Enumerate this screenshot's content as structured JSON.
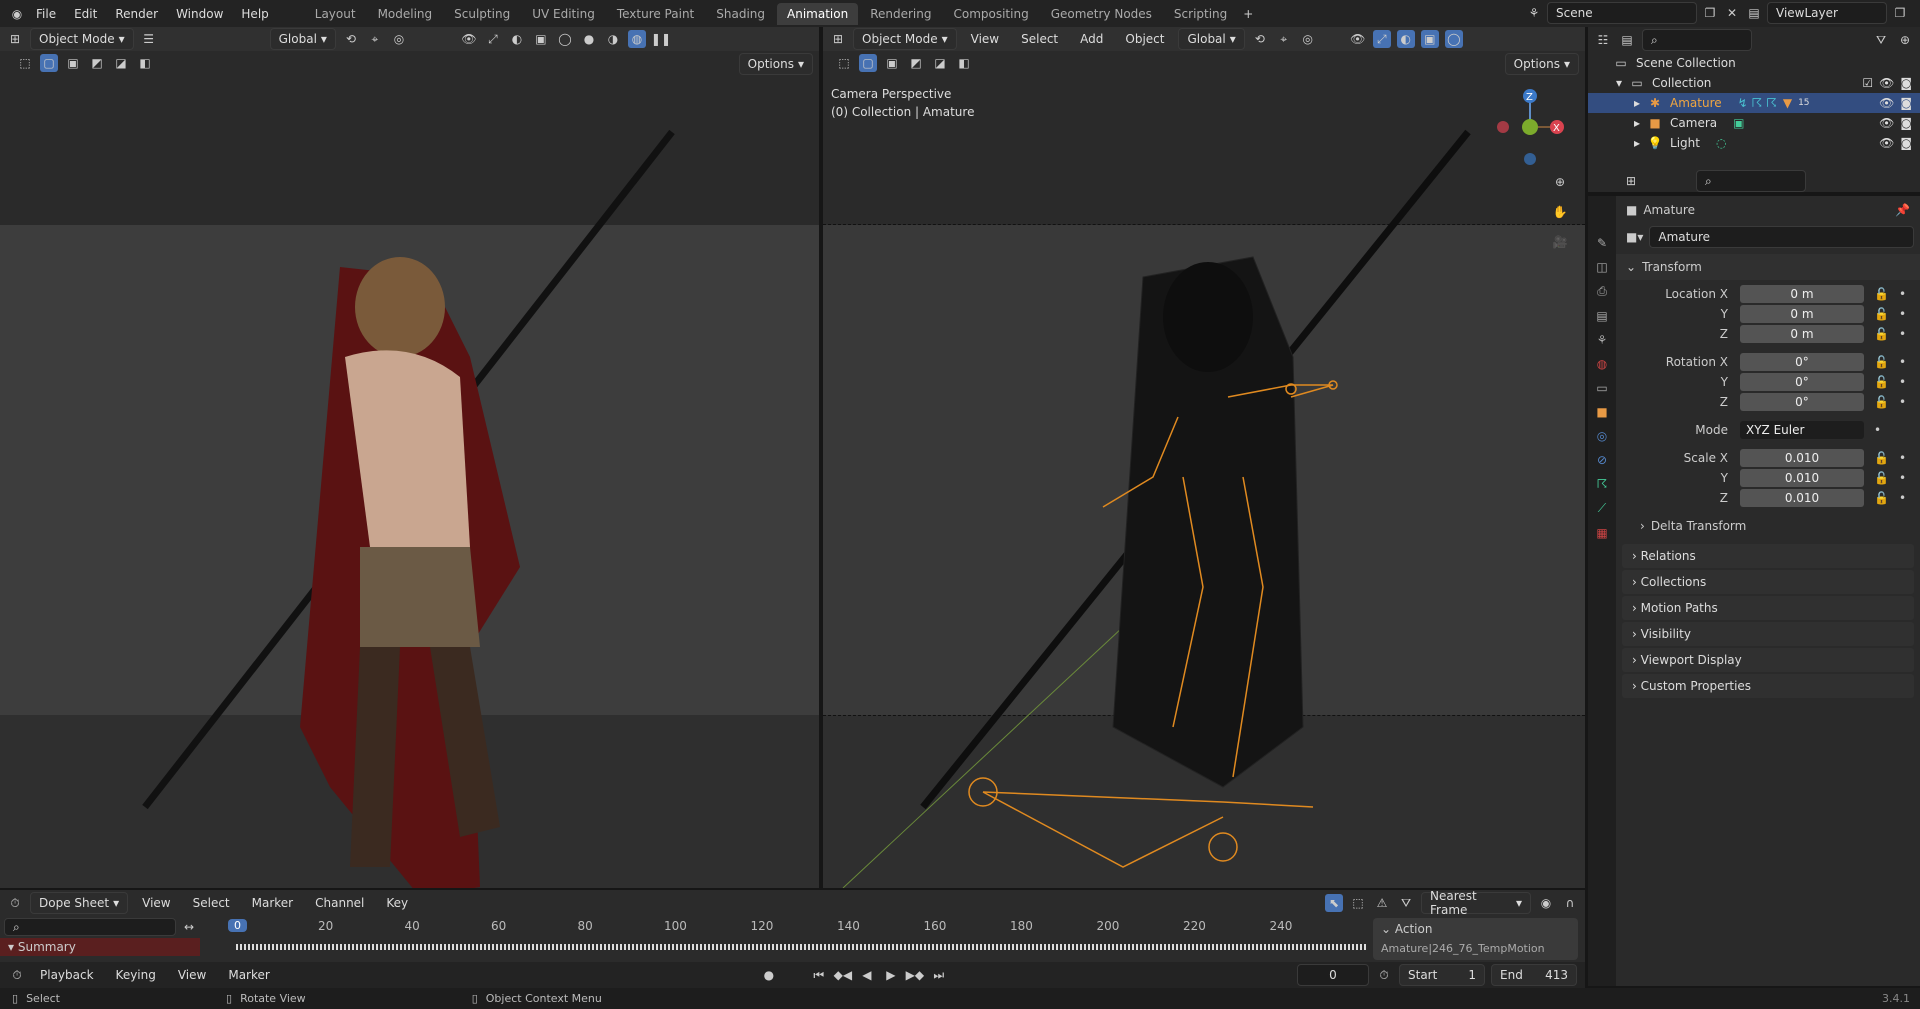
{
  "topbar": {
    "menus": [
      "File",
      "Edit",
      "Render",
      "Window",
      "Help"
    ],
    "workspaces": [
      "Layout",
      "Modeling",
      "Sculpting",
      "UV Editing",
      "Texture Paint",
      "Shading",
      "Animation",
      "Rendering",
      "Compositing",
      "Geometry Nodes",
      "Scripting"
    ],
    "active_workspace": "Animation",
    "scene": "Scene",
    "view_layer": "ViewLayer"
  },
  "left_viewport": {
    "mode": "Object Mode",
    "orientation": "Global",
    "options": "Options"
  },
  "right_viewport": {
    "mode": "Object Mode",
    "menus": [
      "View",
      "Select",
      "Add",
      "Object"
    ],
    "orientation": "Global",
    "options": "Options",
    "overlay_title": "Camera Perspective",
    "overlay_subtitle": "(0) Collection | Amature",
    "gizmo_axes": [
      "Z",
      "X"
    ]
  },
  "outliner": {
    "items": [
      {
        "label": "Scene Collection",
        "icon": "scene-collection-icon"
      },
      {
        "label": "Collection",
        "icon": "collection-icon"
      },
      {
        "label": "Amature",
        "icon": "armature-icon",
        "selected": true,
        "badge": "15"
      },
      {
        "label": "Camera",
        "icon": "camera-icon"
      },
      {
        "label": "Light",
        "icon": "light-icon"
      }
    ]
  },
  "properties": {
    "object_name": "Amature",
    "name_field": "Amature",
    "transform_label": "Transform",
    "rows": [
      {
        "label": "Location X",
        "value": "0 m"
      },
      {
        "label": "Y",
        "value": "0 m"
      },
      {
        "label": "Z",
        "value": "0 m"
      },
      {
        "label": "Rotation X",
        "value": "0°"
      },
      {
        "label": "Y",
        "value": "0°"
      },
      {
        "label": "Z",
        "value": "0°"
      },
      {
        "label": "Mode",
        "value": "XYZ Euler"
      },
      {
        "label": "Scale X",
        "value": "0.010"
      },
      {
        "label": "Y",
        "value": "0.010"
      },
      {
        "label": "Z",
        "value": "0.010"
      }
    ],
    "delta": "Delta Transform",
    "panels": [
      "Relations",
      "Collections",
      "Motion Paths",
      "Visibility",
      "Viewport Display",
      "Custom Properties"
    ]
  },
  "dopesheet": {
    "editor": "Dope Sheet",
    "menus": [
      "View",
      "Select",
      "Marker",
      "Channel",
      "Key"
    ],
    "snap": "Nearest Frame",
    "current_frame": "0",
    "ticks": [
      "20",
      "40",
      "60",
      "80",
      "100",
      "120",
      "140",
      "160",
      "180",
      "200",
      "220",
      "240"
    ],
    "summary": "Summary",
    "action_label": "Action",
    "action_name": "Amature|246_76_TempMotion"
  },
  "timeline": {
    "menus": [
      "Playback",
      "Keying",
      "View",
      "Marker"
    ],
    "frame": "0",
    "start_label": "Start",
    "start": "1",
    "end_label": "End",
    "end": "413"
  },
  "status": {
    "items": [
      "Select",
      "Rotate View",
      "Object Context Menu"
    ],
    "version": "3.4.1"
  }
}
